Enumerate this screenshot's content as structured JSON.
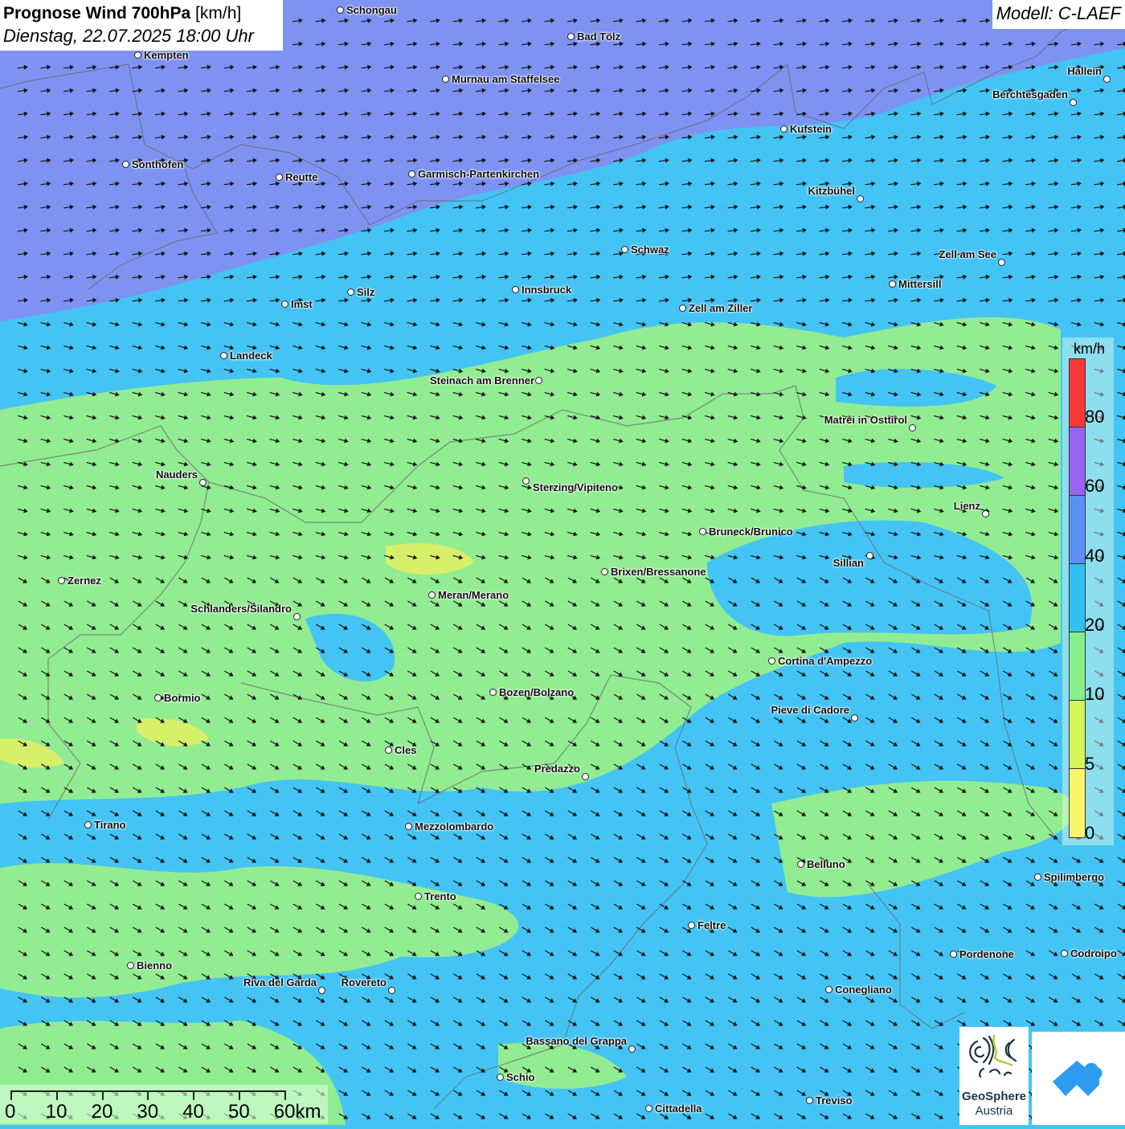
{
  "header": {
    "title_bold": "Prognose Wind 700hPa",
    "title_unit": "[km/h]",
    "subtitle": "Dienstag, 22.07.2025 18:00 Uhr",
    "model": "Modell: C-LAEF"
  },
  "legend": {
    "unit": "km/h",
    "ticks": [
      "80",
      "60",
      "40",
      "20",
      "10",
      "5",
      "0"
    ],
    "colors": [
      "#f93838",
      "#9a62f0",
      "#5c8ff2",
      "#30c0f4",
      "#86ef8a",
      "#d6f55a",
      "#fdf56a"
    ]
  },
  "scale_bar": {
    "labels": [
      "0",
      "10",
      "20",
      "30",
      "40",
      "50",
      "60km"
    ]
  },
  "logos": {
    "geosphere_line1": "GeoSphere",
    "geosphere_line2": "Austria"
  },
  "cities": [
    "Schongau",
    "Bad Tölz",
    "Kempten",
    "Murnau am Staffelsee",
    "Hallein",
    "Berchtesgaden",
    "Kufstein",
    "Sonthofen",
    "Reutte",
    "Garmisch-Partenkirchen",
    "Kitzbühel",
    "Schwaz",
    "Zell am See",
    "Mittersill",
    "Innsbruck",
    "Silz",
    "Imst",
    "Zell am Ziller",
    "Landeck",
    "Steinach am Brenner",
    "Matrei in Osttirol",
    "Nauders",
    "Sterzing/Vipiteno",
    "Lienz",
    "Bruneck/Brunico",
    "Sillian",
    "Brixen/Bressanone",
    "Zernez",
    "Meran/Merano",
    "Schlanders/Silandro",
    "Cortina d'Ampezzo",
    "Bozen/Bolzano",
    "Bormio",
    "Pieve di Cadore",
    "Cles",
    "Predazzo",
    "Tirano",
    "Mezzolombardo",
    "Belluno",
    "Spilimbergo",
    "Trento",
    "Feltre",
    "Pordenone",
    "Codroipo",
    "Bienno",
    "Riva del Garda",
    "Rovereto",
    "Conegliano",
    "Bassano del Grappa",
    "Schio",
    "Treviso",
    "Cittadella"
  ],
  "colors": {
    "band_purple": "#7e92f2",
    "band_cyan": "#44c4f4",
    "band_green": "#92ec92",
    "band_yellow": "#d8ef6a"
  }
}
